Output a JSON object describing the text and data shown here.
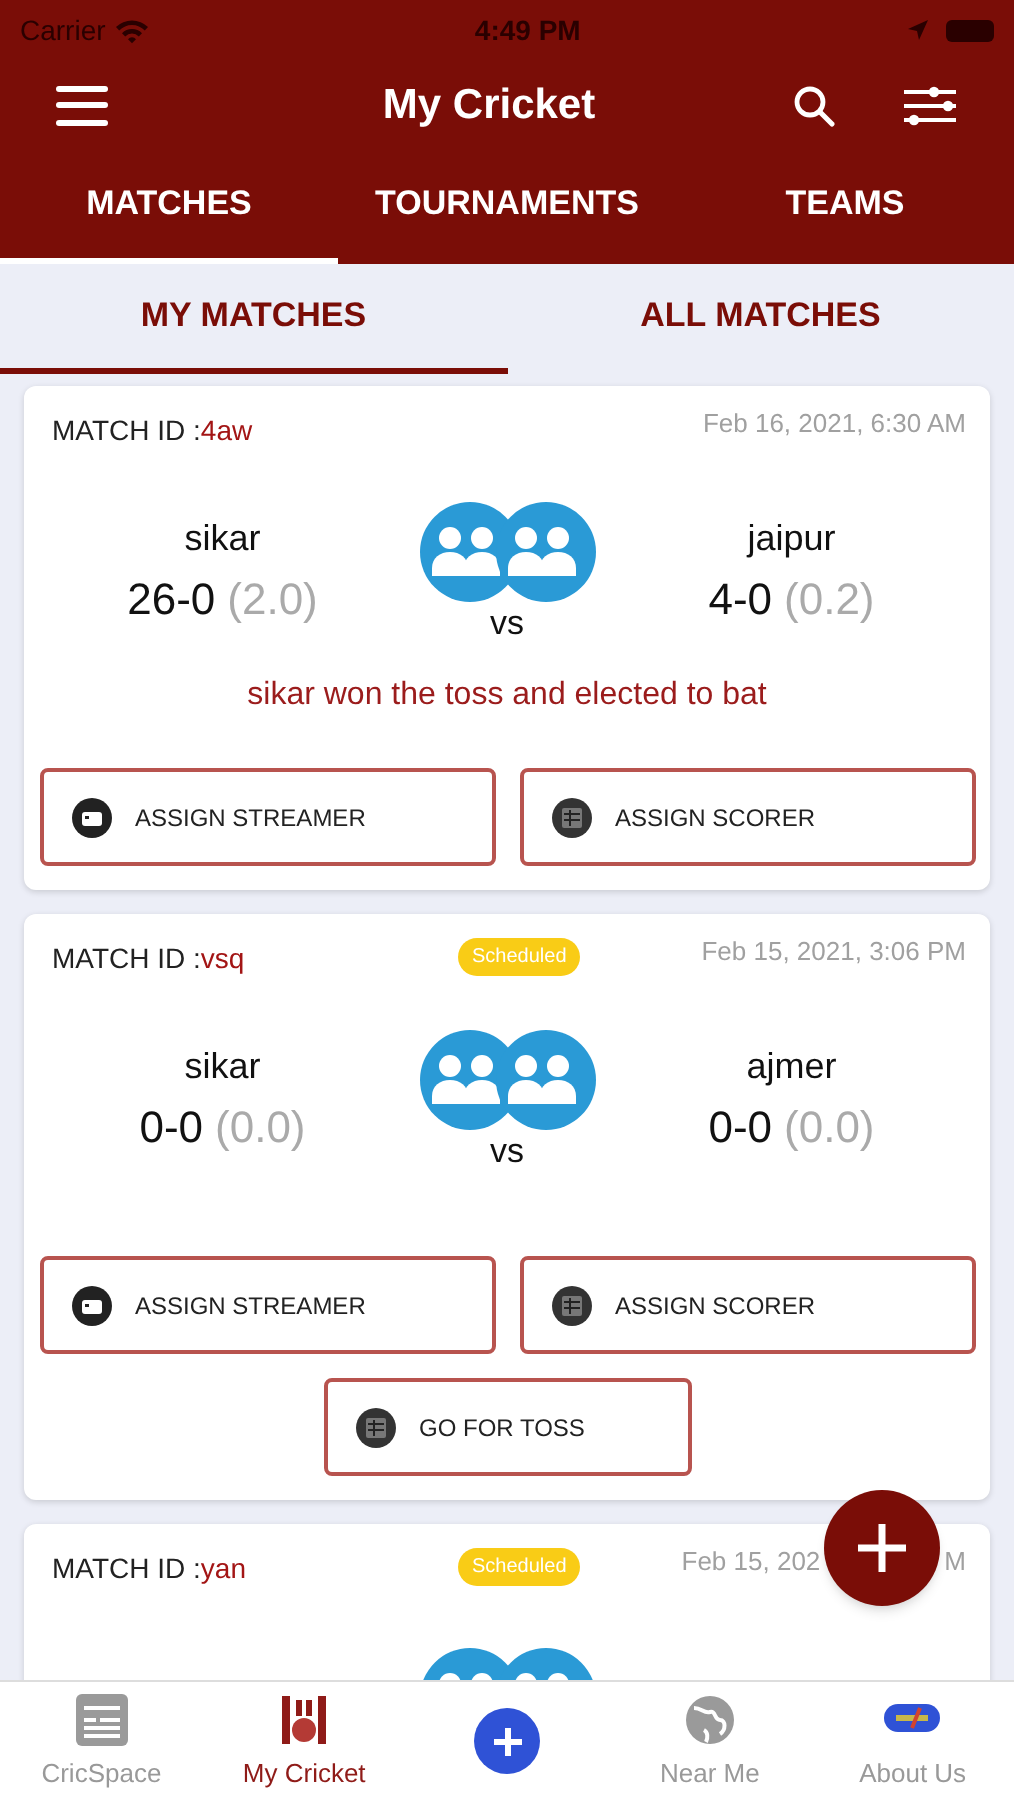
{
  "status_bar": {
    "carrier": "Carrier",
    "time": "4:49 PM"
  },
  "app_bar": {
    "title": "My Cricket"
  },
  "tabs": [
    {
      "label": "MATCHES",
      "selected": true
    },
    {
      "label": "TOURNAMENTS",
      "selected": false
    },
    {
      "label": "TEAMS",
      "selected": false
    }
  ],
  "sub_tabs": [
    {
      "label": "MY MATCHES",
      "selected": true
    },
    {
      "label": "ALL MATCHES",
      "selected": false
    }
  ],
  "matches": [
    {
      "id_label": "MATCH ID :",
      "match_id": "4aw",
      "date": "Feb 16, 2021, 6:30 AM",
      "teams": [
        {
          "name": "sikar",
          "score": "26-0",
          "overs": "(2.0)"
        },
        {
          "name": "jaipur",
          "score": "4-0",
          "overs": "(0.2)"
        }
      ],
      "vs": "vs",
      "toss_result": "sikar won the toss and elected to bat",
      "actions": [
        {
          "kind": "streamer",
          "label": "ASSIGN STREAMER"
        },
        {
          "kind": "scorer",
          "label": "ASSIGN SCORER"
        }
      ]
    },
    {
      "id_label": "MATCH ID :",
      "match_id": "vsq",
      "badge": "Scheduled",
      "date": "Feb 15, 2021, 3:06 PM",
      "teams": [
        {
          "name": "sikar",
          "score": "0-0",
          "overs": "(0.0)"
        },
        {
          "name": "ajmer",
          "score": "0-0",
          "overs": "(0.0)"
        }
      ],
      "vs": "vs",
      "actions": [
        {
          "kind": "streamer",
          "label": "ASSIGN STREAMER"
        },
        {
          "kind": "scorer",
          "label": "ASSIGN SCORER"
        },
        {
          "kind": "toss",
          "label": "GO FOR TOSS"
        }
      ]
    },
    {
      "id_label": "MATCH ID :",
      "match_id": "yan",
      "badge": "Scheduled",
      "date": "Feb 15, 202",
      "date_end": "M"
    }
  ],
  "bottom_nav": [
    {
      "kind": "news",
      "label": "CricSpace",
      "selected": false
    },
    {
      "kind": "cricket",
      "label": "My Cricket",
      "selected": true
    },
    {
      "kind": "add"
    },
    {
      "kind": "globe",
      "label": "Near Me",
      "selected": false
    },
    {
      "kind": "about",
      "label": "About Us",
      "selected": false
    }
  ]
}
